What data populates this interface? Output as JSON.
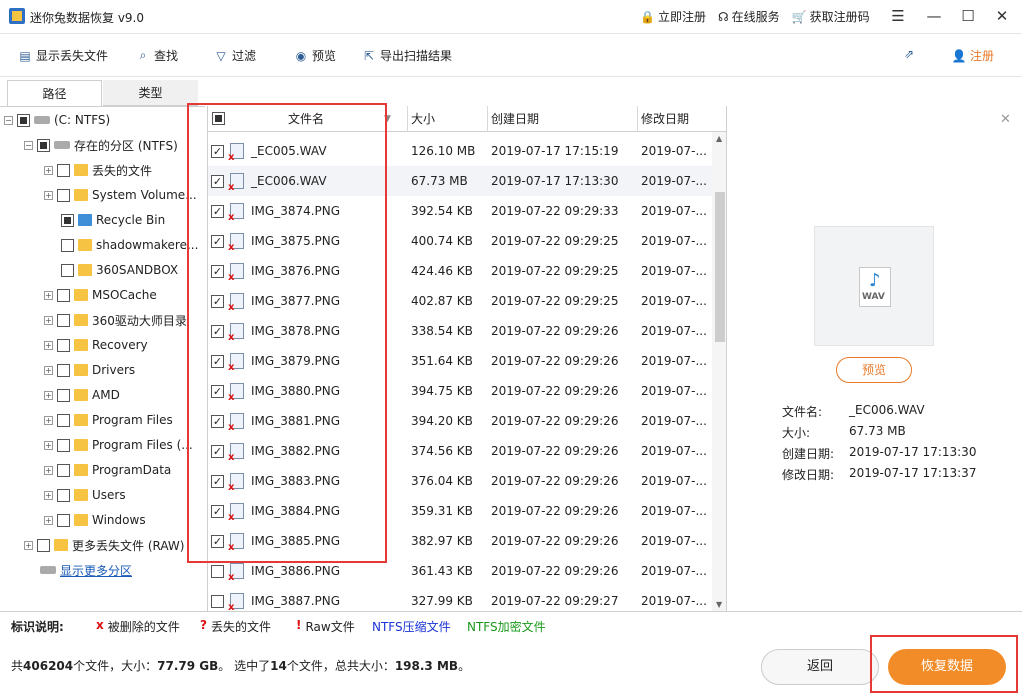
{
  "app": {
    "title": "迷你兔数据恢复 v9.0"
  },
  "titlebar": {
    "links": [
      {
        "icon": "lock-icon",
        "label": "立即注册"
      },
      {
        "icon": "headset-icon",
        "label": "在线服务"
      },
      {
        "icon": "cart-icon",
        "label": "获取注册码"
      }
    ]
  },
  "toolbar": {
    "items": [
      {
        "icon": "document-icon",
        "label": "显示丢失文件"
      },
      {
        "icon": "search-icon",
        "label": "查找"
      },
      {
        "icon": "filter-icon",
        "label": "过滤"
      },
      {
        "icon": "eye-icon",
        "label": "预览"
      },
      {
        "icon": "export-icon",
        "label": "导出扫描结果"
      }
    ],
    "register_label": "注册",
    "accent": "#e87a2a"
  },
  "tabs": [
    {
      "label": "路径"
    },
    {
      "label": "类型"
    }
  ],
  "tree": {
    "root": "(C: NTFS)",
    "partition": "存在的分区 (NTFS)",
    "items": [
      {
        "label": "丢失的文件"
      },
      {
        "label": "System Volume..."
      },
      {
        "label": "Recycle Bin"
      },
      {
        "label": "shadowmakere..."
      },
      {
        "label": "360SANDBOX"
      },
      {
        "label": "MSOCache"
      },
      {
        "label": "360驱动大师目录"
      },
      {
        "label": "Recovery"
      },
      {
        "label": "Drivers"
      },
      {
        "label": "AMD"
      },
      {
        "label": "Program Files"
      },
      {
        "label": "Program Files (..."
      },
      {
        "label": "ProgramData"
      },
      {
        "label": "Users"
      },
      {
        "label": "Windows"
      }
    ],
    "raw": "更多丢失文件 (RAW)",
    "more_link": "显示更多分区"
  },
  "table": {
    "headers": [
      "文件名",
      "大小",
      "创建日期",
      "修改日期"
    ],
    "rows": [
      {
        "name": "_EC005.WAV",
        "size": "126.10 MB",
        "created": "2019-07-17 17:15:19",
        "modified": "2019-07-..."
      },
      {
        "name": "_EC006.WAV",
        "size": "67.73 MB",
        "created": "2019-07-17 17:13:30",
        "modified": "2019-07-..."
      },
      {
        "name": "IMG_3874.PNG",
        "size": "392.54 KB",
        "created": "2019-07-22 09:29:33",
        "modified": "2019-07-..."
      },
      {
        "name": "IMG_3875.PNG",
        "size": "400.74 KB",
        "created": "2019-07-22 09:29:25",
        "modified": "2019-07-..."
      },
      {
        "name": "IMG_3876.PNG",
        "size": "424.46 KB",
        "created": "2019-07-22 09:29:25",
        "modified": "2019-07-..."
      },
      {
        "name": "IMG_3877.PNG",
        "size": "402.87 KB",
        "created": "2019-07-22 09:29:25",
        "modified": "2019-07-..."
      },
      {
        "name": "IMG_3878.PNG",
        "size": "338.54 KB",
        "created": "2019-07-22 09:29:26",
        "modified": "2019-07-..."
      },
      {
        "name": "IMG_3879.PNG",
        "size": "351.64 KB",
        "created": "2019-07-22 09:29:26",
        "modified": "2019-07-..."
      },
      {
        "name": "IMG_3880.PNG",
        "size": "394.75 KB",
        "created": "2019-07-22 09:29:26",
        "modified": "2019-07-..."
      },
      {
        "name": "IMG_3881.PNG",
        "size": "394.20 KB",
        "created": "2019-07-22 09:29:26",
        "modified": "2019-07-..."
      },
      {
        "name": "IMG_3882.PNG",
        "size": "374.56 KB",
        "created": "2019-07-22 09:29:26",
        "modified": "2019-07-..."
      },
      {
        "name": "IMG_3883.PNG",
        "size": "376.04 KB",
        "created": "2019-07-22 09:29:26",
        "modified": "2019-07-..."
      },
      {
        "name": "IMG_3884.PNG",
        "size": "359.31 KB",
        "created": "2019-07-22 09:29:26",
        "modified": "2019-07-..."
      },
      {
        "name": "IMG_3885.PNG",
        "size": "382.97 KB",
        "created": "2019-07-22 09:29:26",
        "modified": "2019-07-..."
      },
      {
        "name": "IMG_3886.PNG",
        "size": "361.43 KB",
        "created": "2019-07-22 09:29:26",
        "modified": "2019-07-..."
      },
      {
        "name": "IMG_3887.PNG",
        "size": "327.99 KB",
        "created": "2019-07-22 09:29:27",
        "modified": "2019-07-..."
      }
    ]
  },
  "preview": {
    "file_type_label": "WAV",
    "button_label": "预览",
    "meta": [
      {
        "key": "文件名:",
        "value": "_EC006.WAV"
      },
      {
        "key": "大小:",
        "value": "67.73 MB"
      },
      {
        "key": "创建日期:",
        "value": "2019-07-17 17:13:30"
      },
      {
        "key": "修改日期:",
        "value": "2019-07-17 17:13:37"
      }
    ]
  },
  "legend": {
    "title": "标识说明:",
    "deleted_mark": "x",
    "deleted": "被删除的文件",
    "lost_mark": "?",
    "lost": "丢失的文件",
    "raw_mark": "!",
    "raw": "Raw文件",
    "ntfs_compressed": "NTFS压缩文件",
    "ntfs_encrypted": "NTFS加密文件",
    "colors": {
      "compressed": "#1a33d6",
      "encrypted": "#1a9a1a"
    }
  },
  "status": {
    "prefix": "共",
    "total_files": "406204",
    "files_unit": "个文件，大小：",
    "total_size": "77.79 GB",
    "selected_prefix": "。 选中了",
    "selected_count": "14",
    "selected_unit": "个文件，总共大小：",
    "selected_size": "198.3 MB",
    "suffix": "。"
  },
  "buttons": {
    "back": "返回",
    "recover": "恢复数据"
  }
}
